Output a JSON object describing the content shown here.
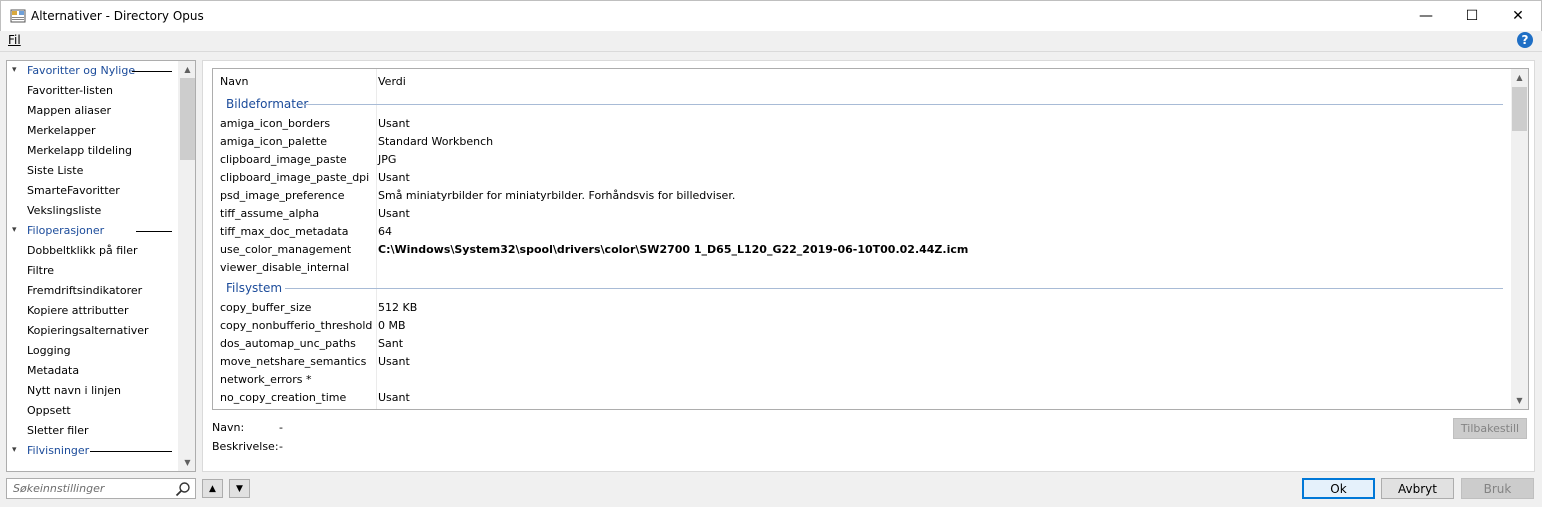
{
  "window": {
    "title": "Alternativer - Directory Opus",
    "minimize_glyph": "—",
    "maximize_glyph": "☐",
    "close_glyph": "✕"
  },
  "menu": {
    "file_label": "Fil"
  },
  "help": {
    "glyph": "?",
    "icon": "help-icon",
    "color": "#1f6fc5"
  },
  "tree": {
    "groups": [
      {
        "label": "Favoritter og Nylige",
        "items": [
          "Favoritter-listen",
          "Mappen aliaser",
          "Merkelapper",
          "Merkelapp tildeling",
          "Siste Liste",
          "SmarteFavoritter",
          "Vekslingsliste"
        ]
      },
      {
        "label": "Filoperasjoner",
        "items": [
          "Dobbeltklikk på filer",
          "Filtre",
          "Fremdriftsindikatorer",
          "Kopiere attributter",
          "Kopieringsalternativer",
          "Logging",
          "Metadata",
          "Nytt navn i linjen",
          "Oppsett",
          "Sletter filer"
        ]
      },
      {
        "label": "Filvisninger",
        "items": []
      }
    ]
  },
  "search": {
    "placeholder": "Søkeinnstillinger",
    "icon": "search-icon"
  },
  "grid": {
    "columns": {
      "name": "Navn",
      "value": "Verdi"
    },
    "sections": [
      {
        "title": "Bildeformater",
        "rows": [
          {
            "name": "amiga_icon_borders",
            "value": "Usant"
          },
          {
            "name": "amiga_icon_palette",
            "value": "Standard Workbench"
          },
          {
            "name": "clipboard_image_paste",
            "value": "JPG"
          },
          {
            "name": "clipboard_image_paste_dpi",
            "value": "Usant"
          },
          {
            "name": "psd_image_preference",
            "value": "Små miniatyrbilder for miniatyrbilder. Forhåndsvis for billedviser."
          },
          {
            "name": "tiff_assume_alpha",
            "value": "Usant"
          },
          {
            "name": "tiff_max_doc_metadata",
            "value": "64"
          },
          {
            "name": "use_color_management",
            "value": "C:\\Windows\\System32\\spool\\drivers\\color\\SW2700 1_D65_L120_G22_2019-06-10T00.02.44Z.icm",
            "bold": true
          },
          {
            "name": "viewer_disable_internal",
            "value": ""
          }
        ]
      },
      {
        "title": "Filsystem",
        "rows": [
          {
            "name": "copy_buffer_size",
            "value": "512 KB"
          },
          {
            "name": "copy_nonbufferio_threshold",
            "value": "0 MB"
          },
          {
            "name": "dos_automap_unc_paths",
            "value": "Sant"
          },
          {
            "name": "move_netshare_semantics",
            "value": "Usant"
          },
          {
            "name": "network_errors *",
            "value": ""
          },
          {
            "name": "no_copy_creation_time",
            "value": "Usant"
          }
        ]
      }
    ]
  },
  "info": {
    "name_label": "Navn:",
    "name_value": "-",
    "description_label": "Beskrivelse:",
    "description_value": "-",
    "reset_label": "Tilbakestill"
  },
  "buttons": {
    "up_glyph": "▲",
    "down_glyph": "▼",
    "ok": "Ok",
    "cancel": "Avbryt",
    "apply": "Bruk"
  }
}
